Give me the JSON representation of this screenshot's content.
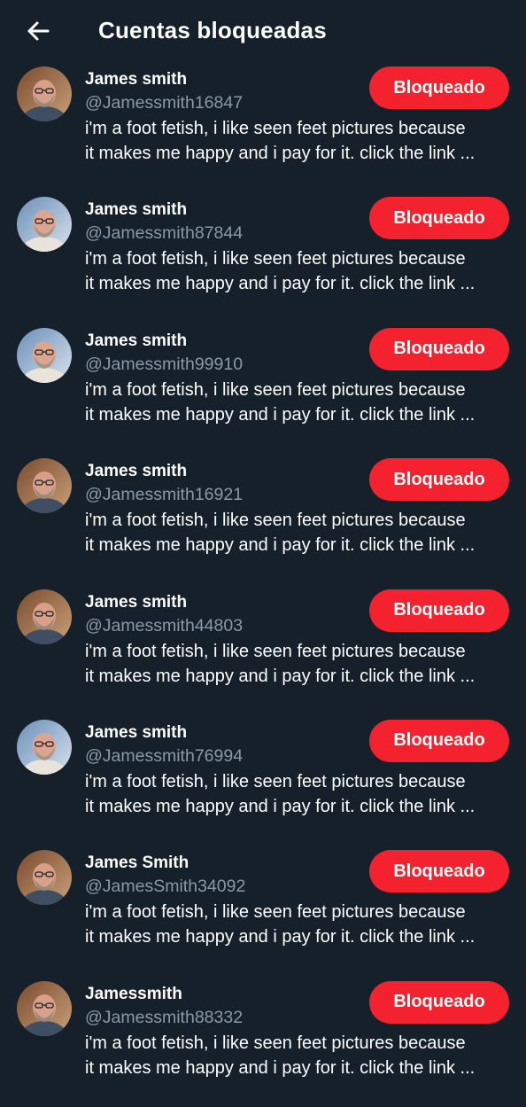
{
  "header": {
    "title": "Cuentas bloqueadas",
    "back_icon": "arrow-left-icon"
  },
  "accounts": [
    {
      "name": "James smith",
      "handle": "@Jamessmith16847",
      "bio_line1": "i'm a foot fetish, i like seen feet pictures because",
      "bio_line2": "it makes me happy and i pay for it. click the link ...",
      "button_label": "Bloqueado",
      "avatar_variant": "brown"
    },
    {
      "name": "James smith",
      "handle": "@Jamessmith87844",
      "bio_line1": "i'm a foot fetish, i like seen feet pictures because",
      "bio_line2": "it makes me happy and i pay for it. click the link ...",
      "button_label": "Bloqueado",
      "avatar_variant": "blue"
    },
    {
      "name": "James smith",
      "handle": "@Jamessmith99910",
      "bio_line1": "i'm a foot fetish, i like seen feet pictures because",
      "bio_line2": "it makes me happy and i pay for it. click the link ...",
      "button_label": "Bloqueado",
      "avatar_variant": "blue"
    },
    {
      "name": "James smith",
      "handle": "@Jamessmith16921",
      "bio_line1": "i'm a foot fetish, i like seen feet pictures because",
      "bio_line2": "it makes me happy and i pay for it. click the link ...",
      "button_label": "Bloqueado",
      "avatar_variant": "brown"
    },
    {
      "name": "James smith",
      "handle": "@Jamessmith44803",
      "bio_line1": "i'm a foot fetish, i like seen feet pictures because",
      "bio_line2": "it makes me happy and i pay for it. click the link ...",
      "button_label": "Bloqueado",
      "avatar_variant": "brown"
    },
    {
      "name": "James smith",
      "handle": "@Jamessmith76994",
      "bio_line1": "i'm a foot fetish, i like seen feet pictures because",
      "bio_line2": "it makes me happy and i pay for it. click the link ...",
      "button_label": "Bloqueado",
      "avatar_variant": "blue"
    },
    {
      "name": "James Smith",
      "handle": "@JamesSmith34092",
      "bio_line1": "i'm a foot fetish, i like seen feet pictures because",
      "bio_line2": "it makes me happy and i pay for it. click the link ...",
      "button_label": "Bloqueado",
      "avatar_variant": "brown"
    },
    {
      "name": "Jamessmith",
      "handle": "@Jamessmith88332",
      "bio_line1": "i'm a foot fetish, i like seen feet pictures because",
      "bio_line2": "it makes me happy and i pay for it. click the link ...",
      "button_label": "Bloqueado",
      "avatar_variant": "brown"
    }
  ],
  "colors": {
    "background": "#15202b",
    "text_primary": "#ffffff",
    "text_secondary": "#8b98a5",
    "blocked_button": "#f4212e"
  }
}
